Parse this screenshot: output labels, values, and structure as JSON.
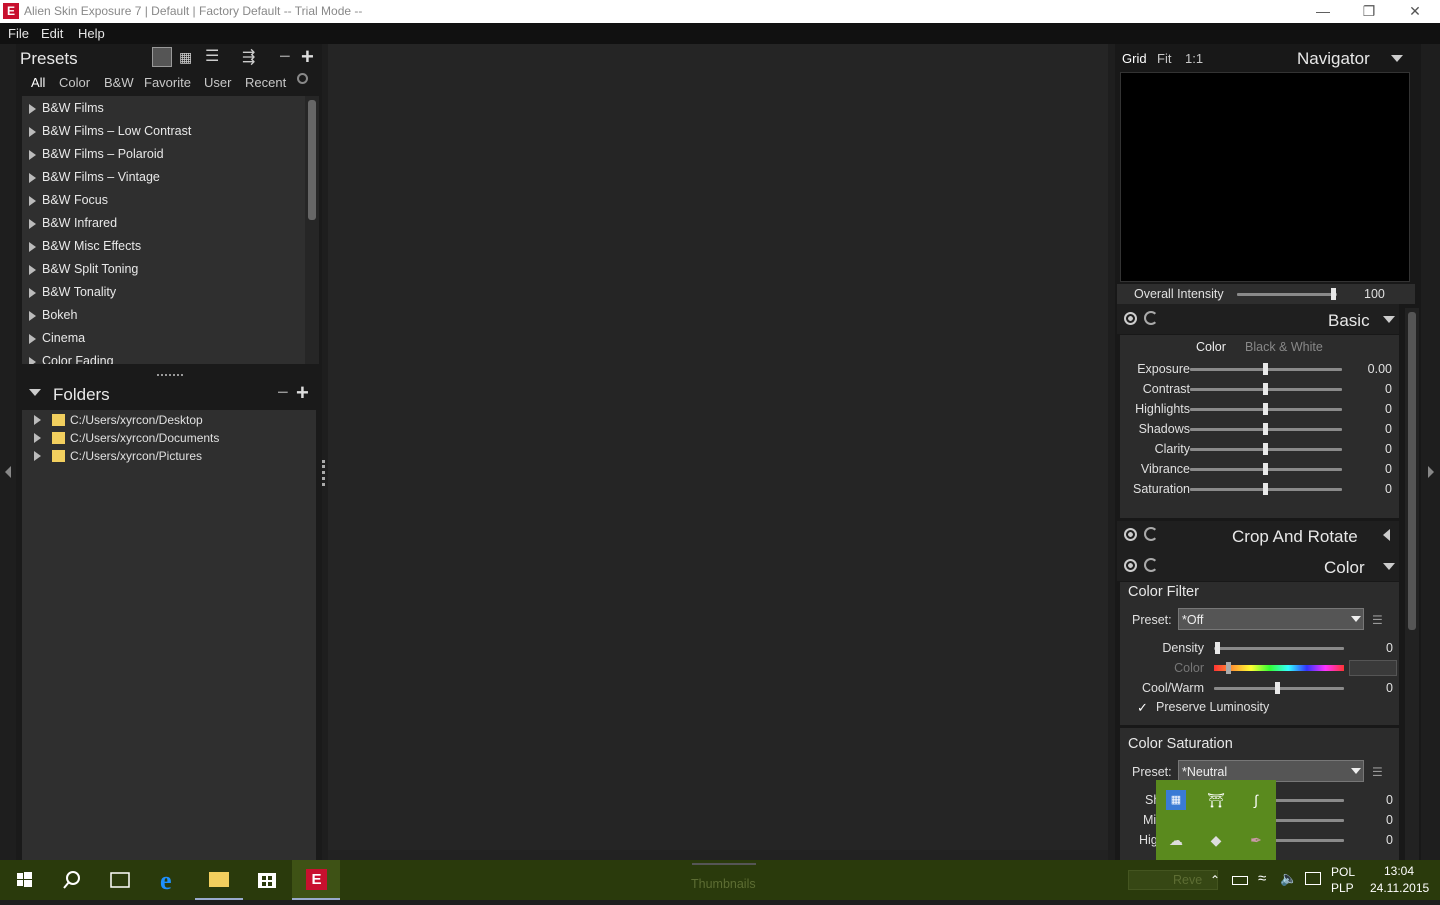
{
  "window": {
    "title": "Alien Skin Exposure 7 | Default | Factory Default -- Trial Mode --",
    "app_icon": "E"
  },
  "menu": [
    "File",
    "Edit",
    "Help"
  ],
  "presets": {
    "title": "Presets",
    "tabs": [
      "All",
      "Color",
      "B&W",
      "Favorite",
      "User",
      "Recent"
    ],
    "items": [
      "B&W Films",
      "B&W Films – Low Contrast",
      "B&W Films – Polaroid",
      "B&W Films – Vintage",
      "B&W Focus",
      "B&W Infrared",
      "B&W Misc Effects",
      "B&W Split Toning",
      "B&W Tonality",
      "Bokeh",
      "Cinema",
      "Color Fading"
    ]
  },
  "folders": {
    "title": "Folders",
    "items": [
      "C:/Users/xyrcon/Desktop",
      "C:/Users/xyrcon/Documents",
      "C:/Users/xyrcon/Pictures"
    ]
  },
  "thumbnails_label": "Thumbnails",
  "navigator": {
    "title": "Navigator",
    "zoom_options": [
      "Grid",
      "Fit",
      "1:1"
    ]
  },
  "overall_intensity": {
    "label": "Overall Intensity",
    "value": "100",
    "fraction": 1.0
  },
  "basic": {
    "title": "Basic",
    "mode_tabs": [
      "Color",
      "Black & White"
    ],
    "rows": [
      {
        "label": "Exposure",
        "value": "0.00"
      },
      {
        "label": "Contrast",
        "value": "0"
      },
      {
        "label": "Highlights",
        "value": "0"
      },
      {
        "label": "Shadows",
        "value": "0"
      },
      {
        "label": "Clarity",
        "value": "0"
      },
      {
        "label": "Vibrance",
        "value": "0"
      },
      {
        "label": "Saturation",
        "value": "0"
      }
    ]
  },
  "crop": {
    "title": "Crop And Rotate"
  },
  "color": {
    "title": "Color",
    "filter": {
      "title": "Color Filter",
      "preset_label": "Preset:",
      "preset_value": "*Off",
      "density": {
        "label": "Density",
        "value": "0"
      },
      "color_label": "Color",
      "coolwarm": {
        "label": "Cool/Warm",
        "value": "0"
      },
      "preserve": "Preserve Luminosity",
      "check": "✓"
    },
    "saturation": {
      "title": "Color Saturation",
      "preset_label": "Preset:",
      "preset_value": "*Neutral",
      "rows": [
        {
          "label": "Sh",
          "value": "0"
        },
        {
          "label": "Mi",
          "value": "0"
        },
        {
          "label": "Hig",
          "value": "0"
        }
      ]
    }
  },
  "reveal_button": "Reve",
  "taskbar": {
    "lang_top": "POL",
    "lang_bottom": "PLP",
    "time": "13:04",
    "date": "24.11.2015"
  },
  "colors": {
    "taskbar": "#2a3a0c",
    "tray_flyout": "#5a8a1e",
    "app_accent": "#c8102e"
  }
}
